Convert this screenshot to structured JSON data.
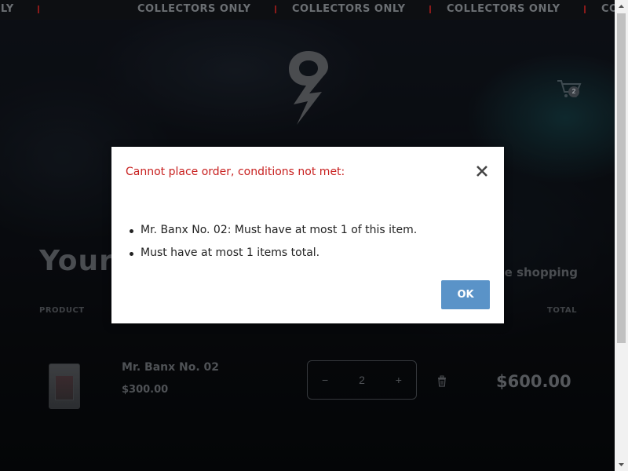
{
  "marquee": {
    "items": [
      "ONLY",
      "COLLECTORS ONLY",
      "COLLECTORS ONLY",
      "COLLECTORS ONLY",
      "COLLECTORS"
    ]
  },
  "header": {
    "logo_icon": "lightning-two-logo",
    "cart_icon": "cart-icon",
    "cart_count": "2"
  },
  "cart_page": {
    "title": "Your",
    "continue_label": "ue shopping",
    "columns": {
      "product": "PRODUCT",
      "total": "TOTAL"
    },
    "item": {
      "name": "Mr. Banx No. 02",
      "price": "$300.00",
      "quantity": "2",
      "minus": "−",
      "plus": "+",
      "line_total": "$600.00"
    }
  },
  "modal": {
    "title": "Cannot place order, conditions not met:",
    "errors": [
      "Mr. Banx No. 02: Must have at most 1 of this item.",
      "Must have at most 1 items total."
    ],
    "ok_label": "OK",
    "title_color": "#c8201f",
    "button_color": "#5a93c8"
  }
}
